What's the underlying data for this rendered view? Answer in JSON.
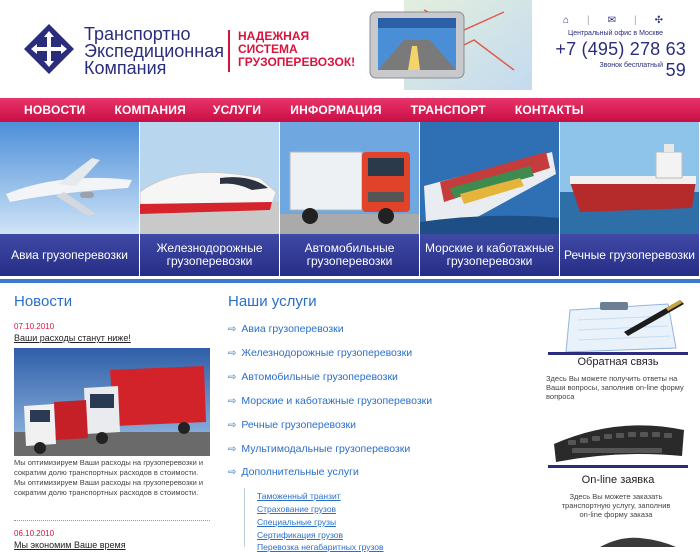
{
  "header": {
    "company_name_line1": "Транспортно",
    "company_name_line2": "Экспедиционная",
    "company_name_line3": "Компания",
    "slogan_line1": "НАДЕЖНАЯ",
    "slogan_line2": "СИСТЕМА",
    "slogan_line3": "ГРУЗОПЕРЕВОЗОК!",
    "icons": [
      "home-icon",
      "mail-icon",
      "sitemap-icon"
    ],
    "office_label": "Центральный офис в Москве",
    "phone": "+7 (495) 278 63 59",
    "phone_note": "Звонок бесплатный"
  },
  "nav": {
    "items": [
      "НОВОСТИ",
      "КОМПАНИЯ",
      "УСЛУГИ",
      "ИНФОРМАЦИЯ",
      "ТРАНСПОРТ",
      "КОНТАКТЫ"
    ]
  },
  "categories": [
    {
      "line1": "Авиа грузоперевозки",
      "line2": ""
    },
    {
      "line1": "Железнодорожные",
      "line2": "грузоперевозки"
    },
    {
      "line1": "Автомобильные",
      "line2": "грузоперевозки"
    },
    {
      "line1": "Морские и каботажные",
      "line2": "грузоперевозки"
    },
    {
      "line1": "Речные грузоперевозки",
      "line2": ""
    }
  ],
  "news": {
    "title": "Новости",
    "item1": {
      "date": "07.10.2010",
      "headline": "Ваши расходы станут ниже!",
      "body_line1": "Мы оптимизируем Ваши расходы на грузоперевозки и",
      "body_line2": "сократим долю транспортных расходов в стоимости.",
      "body_line3": "Мы оптимизируем Ваши расходы на грузоперевозки и",
      "body_line4": "сократим долю транспортных расходов в стоимости."
    },
    "item2": {
      "date": "06.10.2010",
      "headline": "Мы экономим Ваше время"
    }
  },
  "services": {
    "title": "Наши услуги",
    "items": [
      "Авиа грузоперевозки",
      "Железнодорожные грузоперевозки",
      "Автомобильные грузоперевозки",
      "Морские и каботажные грузоперевозки",
      "Речные грузоперевозки",
      "Мультимодальные грузоперевозки",
      "Дополнительные услуги"
    ],
    "sub_items": [
      "Таможенный транзит",
      "Страхование грузов",
      "Специальные грузы",
      "Сертификация грузов",
      "Перевозка негабаритных грузов"
    ]
  },
  "sidebar": {
    "feedback": {
      "title": "Обратная связь",
      "text_line1": "Здесь Вы можете получить ответы на",
      "text_line2": "Ваши вопросы, заполнив on-line форму",
      "text_line3": "вопроса"
    },
    "order": {
      "title": "On-line заявка",
      "text_line1": "Здесь Вы можете заказать",
      "text_line2": "транспортную услугу, заполнив",
      "text_line3": "on-line форму заказа"
    }
  },
  "colors": {
    "brand_blue": "#2a2d7c",
    "accent_red": "#d9143c",
    "link_blue": "#2a6fc9",
    "nav_pink": "#e0245a"
  }
}
